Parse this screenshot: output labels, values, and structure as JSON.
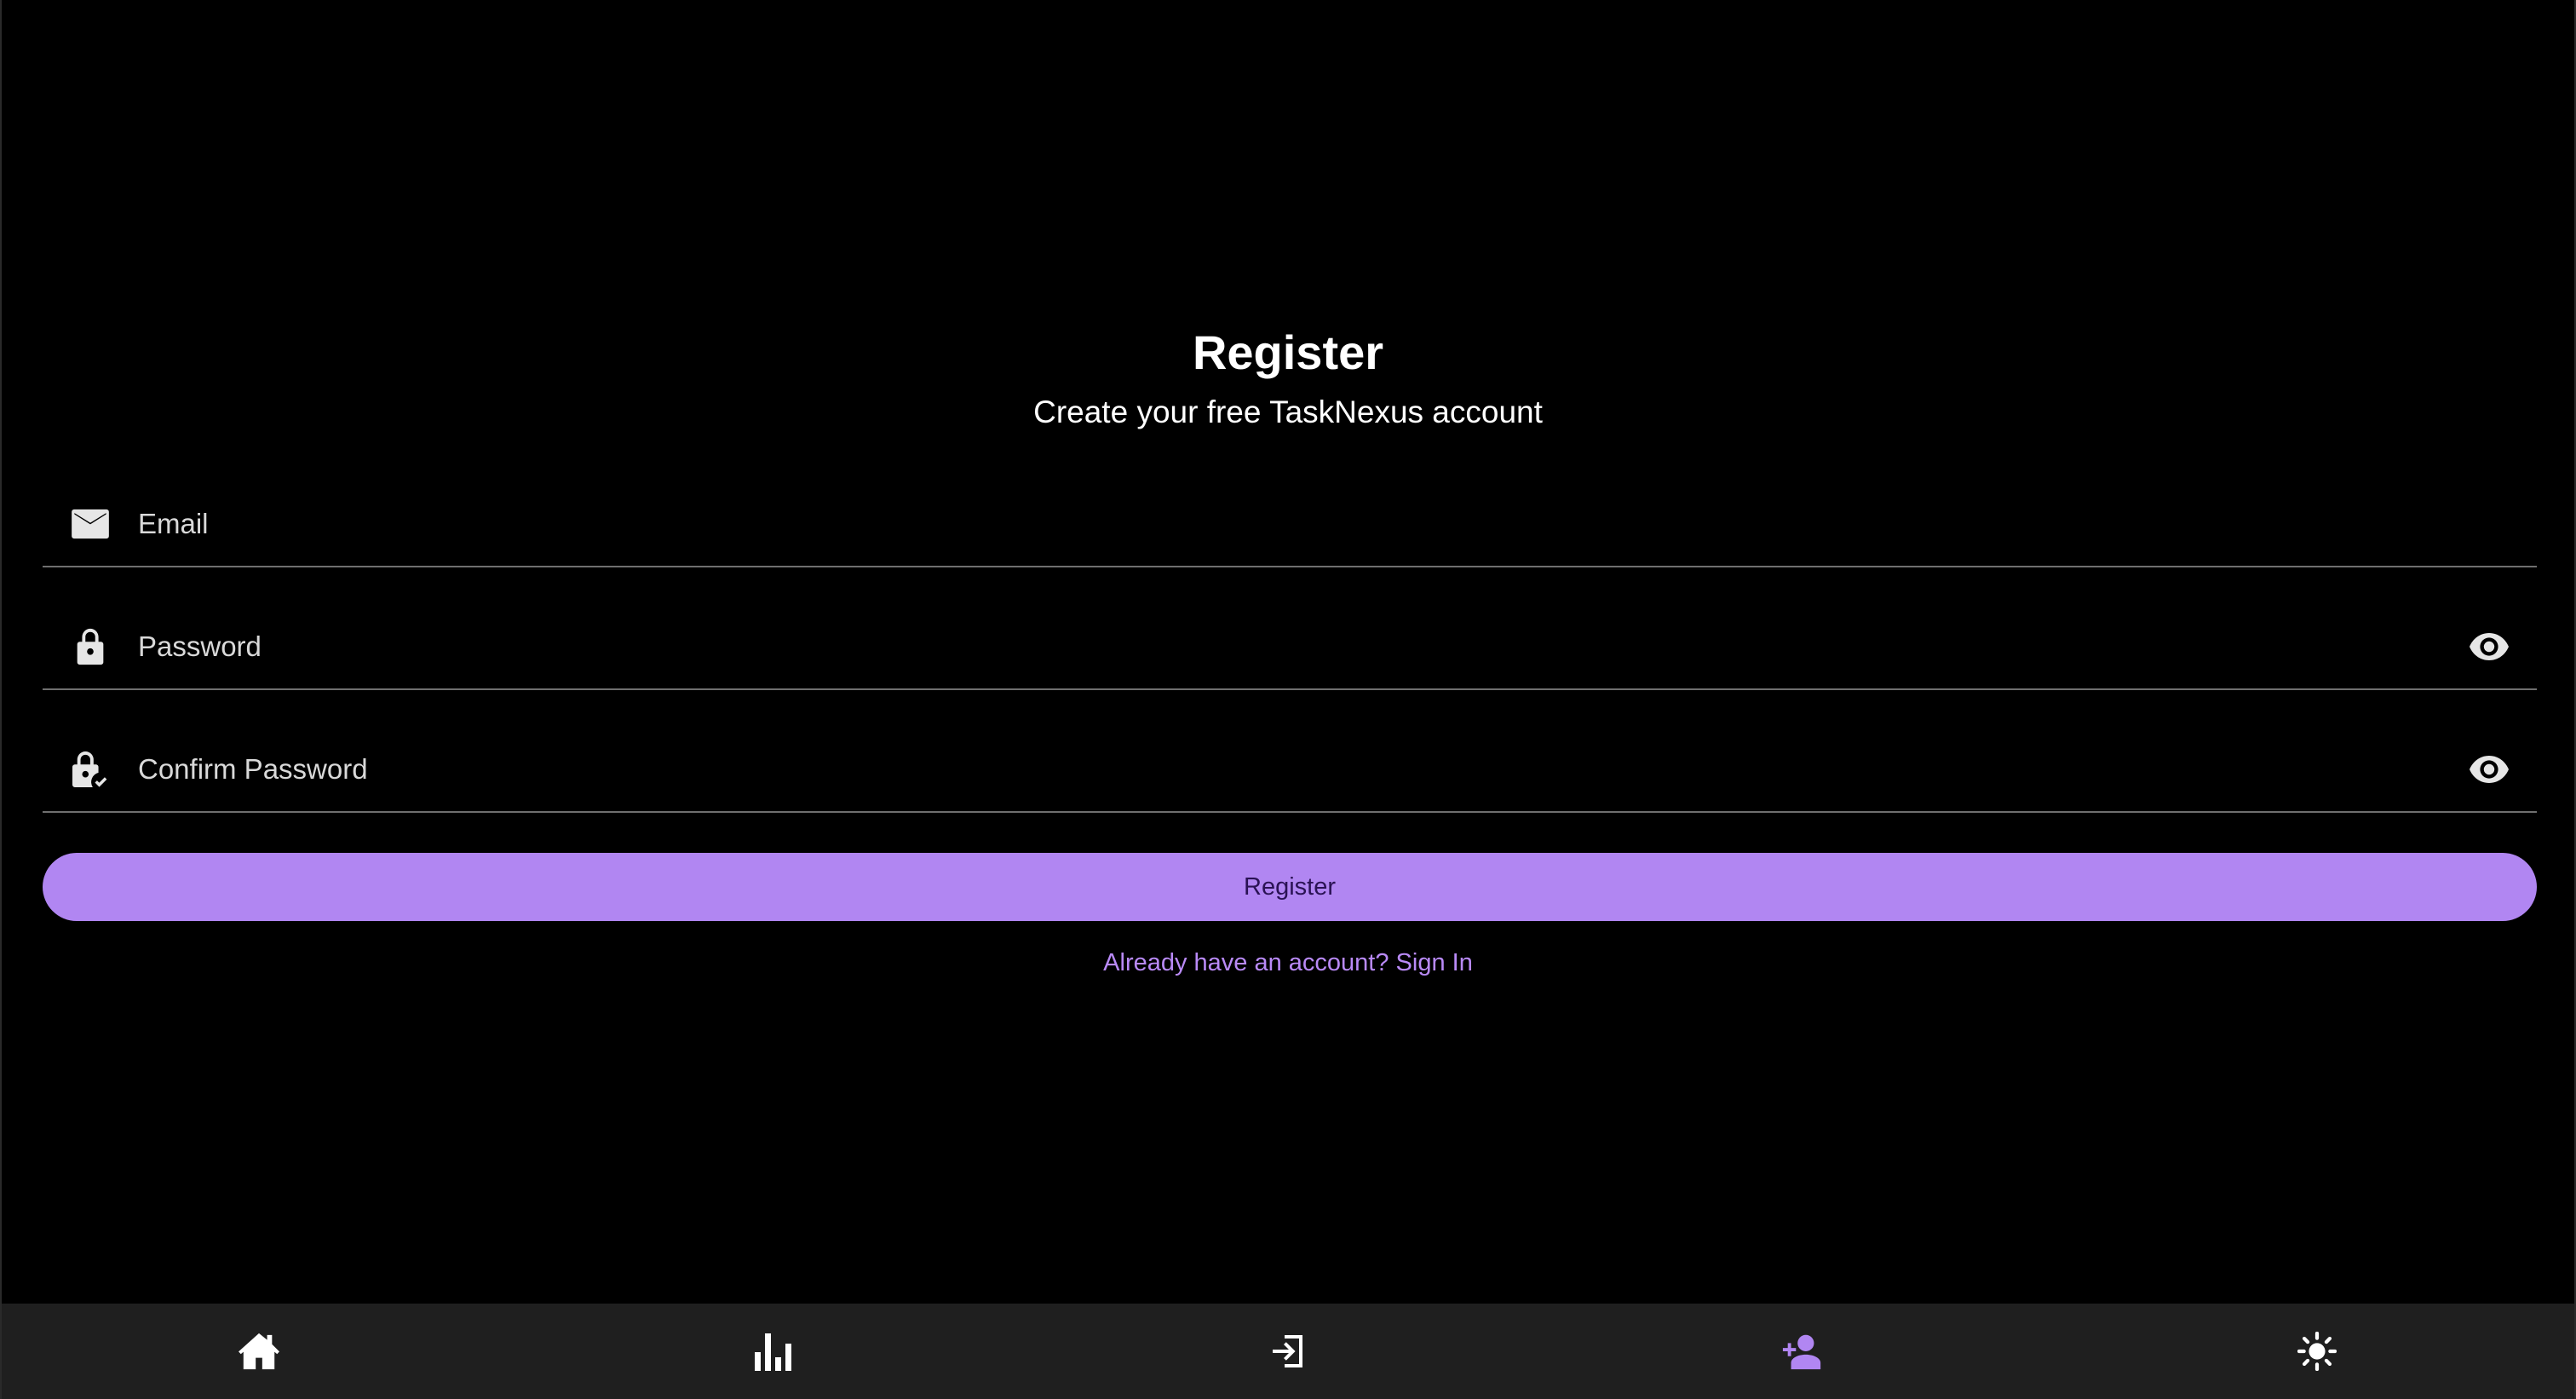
{
  "page": {
    "title": "Register",
    "subtitle": "Create your free TaskNexus account"
  },
  "form": {
    "email": {
      "value": "",
      "placeholder": "Email",
      "icon": "mail-icon"
    },
    "password": {
      "value": "",
      "placeholder": "Password",
      "icon": "lock-icon",
      "toggle_icon": "eye-icon"
    },
    "confirm_password": {
      "value": "",
      "placeholder": "Confirm Password",
      "icon": "lock-check-icon",
      "toggle_icon": "eye-icon"
    },
    "submit_label": "Register",
    "signin_link": "Already have an account? Sign In"
  },
  "bottom_nav": {
    "items": [
      {
        "icon": "home-icon",
        "active": false
      },
      {
        "icon": "bar-chart-icon",
        "active": false
      },
      {
        "icon": "login-icon",
        "active": false
      },
      {
        "icon": "person-add-icon",
        "active": true
      },
      {
        "icon": "sun-icon",
        "active": false
      }
    ]
  },
  "colors": {
    "background": "#000000",
    "accent": "#b186f2",
    "link": "#b98af7",
    "nav_background": "#1f1f1f",
    "nav_icon": "#ffffff",
    "nav_icon_active": "#b186f2"
  }
}
